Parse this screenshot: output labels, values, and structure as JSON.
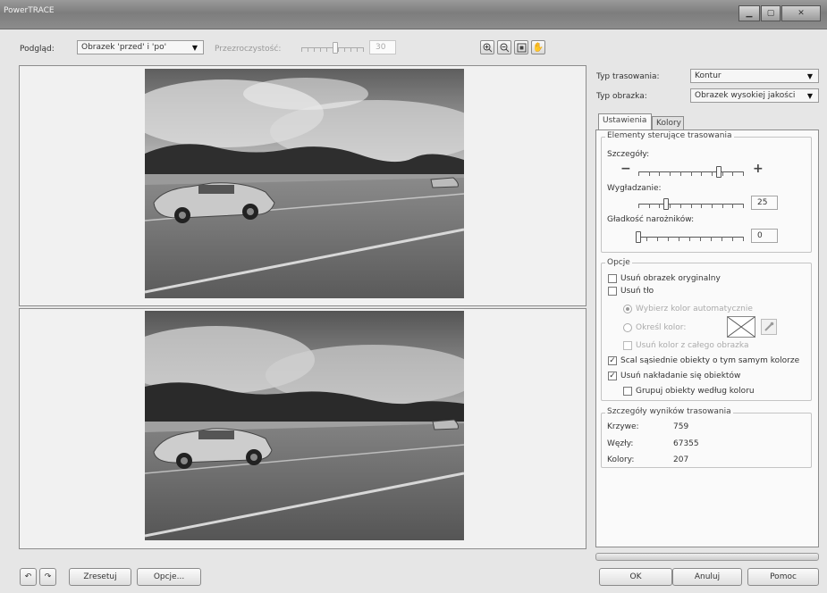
{
  "window": {
    "title": "PowerTRACE"
  },
  "toolbar": {
    "preview_label": "Podgląd:",
    "preview_value": "Obrazek 'przed' i 'po'",
    "transparency_label": "Przezroczystość:",
    "transparency_value": "30",
    "transparency_level": 0.55,
    "tools": [
      "zoom-in-icon",
      "zoom-out-icon",
      "fit-icon",
      "pan-hand-icon"
    ]
  },
  "right": {
    "trace_type_label": "Typ trasowania:",
    "trace_type_value": "Kontur",
    "image_type_label": "Typ obrazka:",
    "image_type_value": "Obrazek wysokiej jakości",
    "tabs": [
      "Ustawienia",
      "Kolory"
    ],
    "controls": {
      "title": "Elementy sterujące trasowania",
      "detail_label": "Szczegóły:",
      "detail_level": 0.78,
      "smoothing_label": "Wygładzanie:",
      "smoothing_value": "25",
      "smoothing_level": 0.25,
      "corner_label": "Gładkość narożników:",
      "corner_value": "0",
      "corner_level": 0.0,
      "minus": "−",
      "plus": "+"
    },
    "options": {
      "title": "Opcje",
      "remove_original": "Usuń obrazek oryginalny",
      "remove_bg": "Usuń tło",
      "auto_color": "Wybierz kolor automatycznie",
      "pick_color": "Określ kolor:",
      "remove_all": "Usuń kolor z całego obrazka",
      "merge": "Scal sąsiednie obiekty o tym samym kolorze",
      "remove_overlap": "Usuń nakładanie się obiektów",
      "group_by_color": "Grupuj obiekty według koloru"
    },
    "details": {
      "title": "Szczegóły wyników trasowania",
      "curves_label": "Krzywe:",
      "curves_value": "759",
      "nodes_label": "Węzły:",
      "nodes_value": "67355",
      "colors_label": "Kolory:",
      "colors_value": "207"
    }
  },
  "bottom": {
    "reset": "Zresetuj",
    "options": "Opcje...",
    "ok": "OK",
    "cancel": "Anuluj",
    "help": "Pomoc"
  }
}
